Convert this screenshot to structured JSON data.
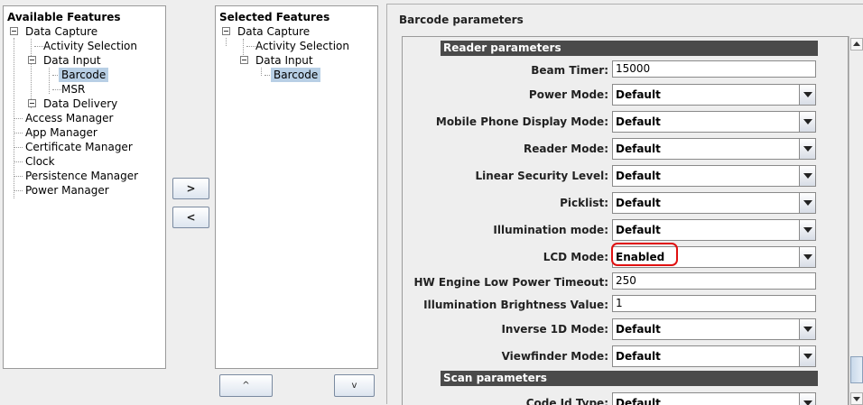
{
  "available_panel": {
    "title": "Available Features",
    "nodes": [
      {
        "label": "Data Capture"
      },
      {
        "label": "Activity Selection"
      },
      {
        "label": "Data Input"
      },
      {
        "label": "Barcode"
      },
      {
        "label": "MSR"
      },
      {
        "label": "Data Delivery"
      },
      {
        "label": "Access Manager"
      },
      {
        "label": "App Manager"
      },
      {
        "label": "Certificate Manager"
      },
      {
        "label": "Clock"
      },
      {
        "label": "Persistence Manager"
      },
      {
        "label": "Power Manager"
      }
    ]
  },
  "selected_panel": {
    "title": "Selected Features",
    "nodes": [
      {
        "label": "Data Capture"
      },
      {
        "label": "Activity Selection"
      },
      {
        "label": "Data Input"
      },
      {
        "label": "Barcode"
      }
    ]
  },
  "buttons": {
    "move_right": ">",
    "move_left": "<",
    "move_up": "^",
    "move_down": "v"
  },
  "params": {
    "title": "Barcode parameters",
    "reader_section": "Reader parameters",
    "scan_section": "Scan parameters",
    "rows": [
      {
        "label": "Beam Timer:",
        "value": "15000"
      },
      {
        "label": "Power Mode:",
        "value": "Default"
      },
      {
        "label": "Mobile Phone Display Mode:",
        "value": "Default"
      },
      {
        "label": "Reader Mode:",
        "value": "Default"
      },
      {
        "label": "Linear Security Level:",
        "value": "Default"
      },
      {
        "label": "Picklist:",
        "value": "Default"
      },
      {
        "label": "Illumination mode:",
        "value": "Default"
      },
      {
        "label": "LCD Mode:",
        "value": "Enabled"
      },
      {
        "label": "HW Engine Low Power Timeout:",
        "value": "250"
      },
      {
        "label": "Illumination Brightness Value:",
        "value": "1"
      },
      {
        "label": "Inverse 1D Mode:",
        "value": "Default"
      },
      {
        "label": "Viewfinder Mode:",
        "value": "Default"
      },
      {
        "label": "Code Id Type:",
        "value": "Default"
      }
    ]
  },
  "colors": {
    "selection": "#b8cfe5",
    "section_header": "#4a4a4a",
    "highlight_ring": "#e01010"
  }
}
